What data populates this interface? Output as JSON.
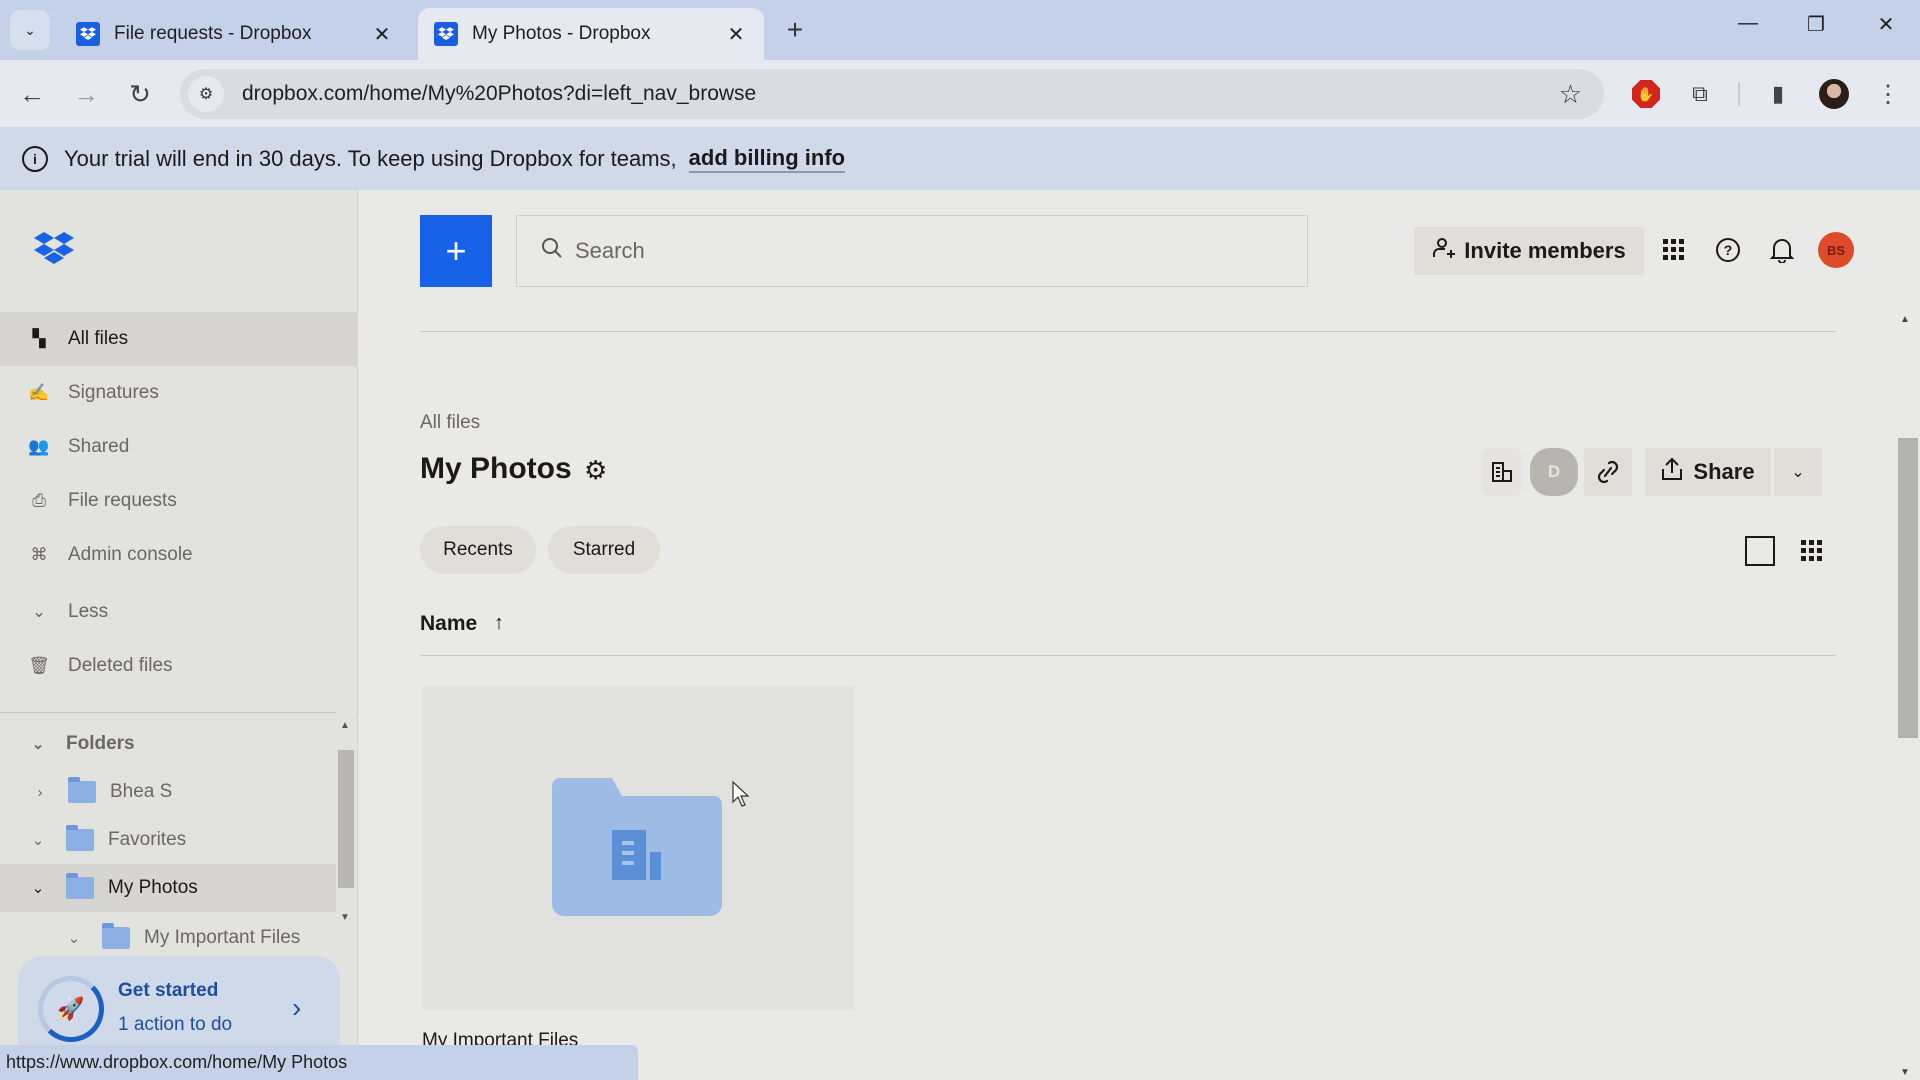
{
  "browser": {
    "tabs": [
      {
        "title": "File requests - Dropbox",
        "active": false
      },
      {
        "title": "My Photos - Dropbox",
        "active": true
      }
    ],
    "url": "dropbox.com/home/My%20Photos?di=left_nav_browse",
    "status_url": "https://www.dropbox.com/home/My Photos",
    "icons": {
      "tab_search": "chevron-down-icon",
      "back": "←",
      "forward": "→",
      "reload": "↻",
      "new_tab": "+",
      "close": "✕",
      "minimize": "—",
      "restore": "❐",
      "win_close": "✕",
      "star": "☆",
      "extensions": "⧉",
      "side_panel": "▮",
      "menu": "⋮",
      "site_info": "⚙"
    }
  },
  "banner": {
    "text": "Your trial will end in 30 days. To keep using Dropbox for teams,",
    "link": "add billing info",
    "info_glyph": "i"
  },
  "sidebar": {
    "nav": [
      {
        "label": "All files",
        "icon": "▚",
        "active": true
      },
      {
        "label": "Signatures",
        "icon": "✍",
        "active": false
      },
      {
        "label": "Shared",
        "icon": "👥",
        "active": false
      },
      {
        "label": "File requests",
        "icon": "⎙",
        "active": false
      },
      {
        "label": "Admin console",
        "icon": "⌘",
        "active": false
      },
      {
        "label": "Less",
        "icon": "⌄",
        "active": false
      },
      {
        "label": "Deleted files",
        "icon": "🗑",
        "active": false
      }
    ],
    "folders_header": "Folders",
    "folders": [
      {
        "label": "Bhea S",
        "chevron": "›",
        "expanded": false,
        "active": false
      },
      {
        "label": "Favorites",
        "chevron": "⌄",
        "expanded": true,
        "active": false
      },
      {
        "label": "My Photos",
        "chevron": "⌄",
        "expanded": true,
        "active": true
      },
      {
        "label": "My Important Files",
        "chevron": "⌄",
        "expanded": true,
        "active": false
      }
    ],
    "get_started": {
      "title": "Get started",
      "subtitle": "1 action to do",
      "progress": 0.75
    }
  },
  "topbar": {
    "add_glyph": "+",
    "search_placeholder": "Search",
    "invite_label": "Invite members",
    "avatar_initials": "BS",
    "avatar_color": "#dd4c2a"
  },
  "content": {
    "breadcrumb": "All files",
    "title": "My Photos",
    "member_avatar": "D",
    "share_label": "Share",
    "chips": [
      "Recents",
      "Starred"
    ],
    "column_name": "Name",
    "sort_glyph": "↑",
    "items": [
      {
        "name": "My Important Files",
        "type": "team-folder"
      }
    ]
  },
  "colors": {
    "accent": "#1762e6",
    "folder": "#9dbbe4",
    "banner": "#cfd9e9"
  }
}
